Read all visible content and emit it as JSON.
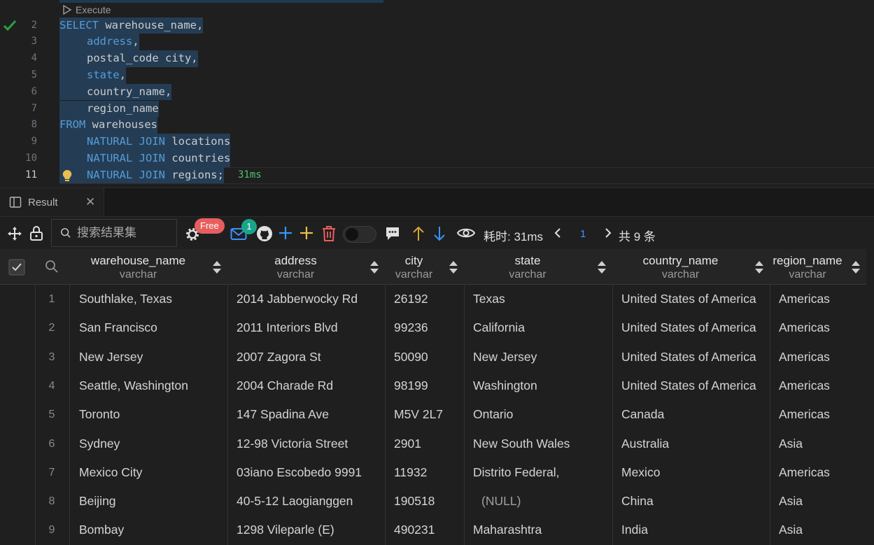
{
  "editor": {
    "codelens": "Execute",
    "timing": "31ms",
    "lines": [
      {
        "num": "2",
        "parts": [
          {
            "t": "SELECT",
            "k": 1
          },
          {
            "t": " warehouse_name,",
            "k": 0
          }
        ]
      },
      {
        "num": "3",
        "indent": true,
        "parts": [
          {
            "t": "address",
            "k": 1
          },
          {
            "t": ",",
            "k": 0
          }
        ]
      },
      {
        "num": "4",
        "indent": true,
        "parts": [
          {
            "t": "postal_code city,",
            "k": 0
          }
        ]
      },
      {
        "num": "5",
        "indent": true,
        "parts": [
          {
            "t": "state",
            "k": 1
          },
          {
            "t": ",",
            "k": 0
          }
        ]
      },
      {
        "num": "6",
        "indent": true,
        "parts": [
          {
            "t": "country_name,",
            "k": 0
          }
        ]
      },
      {
        "num": "7",
        "indent": true,
        "parts": [
          {
            "t": "region_name",
            "k": 0
          }
        ]
      },
      {
        "num": "8",
        "parts": [
          {
            "t": "FROM",
            "k": 1
          },
          {
            "t": " warehouses",
            "k": 0
          }
        ]
      },
      {
        "num": "9",
        "indent": true,
        "parts": [
          {
            "t": "NATURAL JOIN",
            "k": 1
          },
          {
            "t": " locations",
            "k": 0
          }
        ]
      },
      {
        "num": "10",
        "indent": true,
        "parts": [
          {
            "t": "NATURAL JOIN",
            "k": 1
          },
          {
            "t": " countries",
            "k": 0
          }
        ]
      },
      {
        "num": "11",
        "indent": true,
        "parts": [
          {
            "t": "NATURAL JOIN",
            "k": 1
          },
          {
            "t": " regions;",
            "k": 0
          }
        ]
      }
    ]
  },
  "panel": {
    "tab_label": "Result",
    "search_placeholder": "搜索结果集",
    "free_badge": "Free",
    "mail_count": "1",
    "elapsed": "耗时: 31ms",
    "page": "1",
    "total": "共 9 条"
  },
  "grid": {
    "columns": [
      {
        "name": "warehouse_name",
        "type": "varchar"
      },
      {
        "name": "address",
        "type": "varchar"
      },
      {
        "name": "city",
        "type": "varchar"
      },
      {
        "name": "state",
        "type": "varchar"
      },
      {
        "name": "country_name",
        "type": "varchar"
      },
      {
        "name": "region_name",
        "type": "varchar"
      }
    ],
    "null_text": "(NULL)",
    "rows": [
      {
        "n": "1",
        "cells": [
          "Southlake, Texas",
          "2014 Jabberwocky Rd",
          "26192",
          "Texas",
          "United States of America",
          "Americas"
        ]
      },
      {
        "n": "2",
        "cells": [
          "San Francisco",
          "2011 Interiors Blvd",
          "99236",
          "California",
          "United States of America",
          "Americas"
        ]
      },
      {
        "n": "3",
        "cells": [
          "New Jersey",
          "2007 Zagora St",
          "50090",
          "New Jersey",
          "United States of America",
          "Americas"
        ]
      },
      {
        "n": "4",
        "cells": [
          "Seattle, Washington",
          "2004 Charade Rd",
          "98199",
          "Washington",
          "United States of America",
          "Americas"
        ]
      },
      {
        "n": "5",
        "cells": [
          "Toronto",
          "147 Spadina Ave",
          "M5V 2L7",
          "Ontario",
          "Canada",
          "Americas"
        ]
      },
      {
        "n": "6",
        "cells": [
          "Sydney",
          "12-98 Victoria Street",
          "2901",
          "New South Wales",
          "Australia",
          "Asia"
        ]
      },
      {
        "n": "7",
        "cells": [
          "Mexico City",
          "03iano Escobedo 9991",
          "11932",
          "Distrito Federal,",
          "Mexico",
          "Americas"
        ]
      },
      {
        "n": "8",
        "cells": [
          "Beijing",
          "40-5-12 Laogianggen",
          "190518",
          null,
          "China",
          "Asia"
        ]
      },
      {
        "n": "9",
        "cells": [
          "Bombay",
          "1298 Vileparle (E)",
          "490231",
          "Maharashtra",
          "India",
          "Asia"
        ]
      }
    ]
  }
}
